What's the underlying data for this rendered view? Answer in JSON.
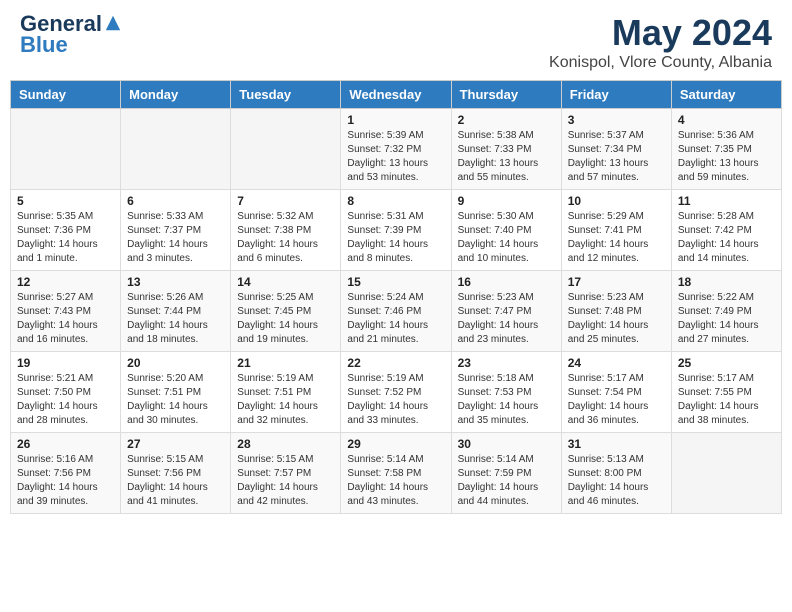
{
  "header": {
    "logo_line1": "General",
    "logo_line2": "Blue",
    "month_title": "May 2024",
    "location": "Konispol, Vlore County, Albania"
  },
  "weekdays": [
    "Sunday",
    "Monday",
    "Tuesday",
    "Wednesday",
    "Thursday",
    "Friday",
    "Saturday"
  ],
  "weeks": [
    [
      {
        "day": "",
        "sunrise": "",
        "sunset": "",
        "daylight": ""
      },
      {
        "day": "",
        "sunrise": "",
        "sunset": "",
        "daylight": ""
      },
      {
        "day": "",
        "sunrise": "",
        "sunset": "",
        "daylight": ""
      },
      {
        "day": "1",
        "sunrise": "Sunrise: 5:39 AM",
        "sunset": "Sunset: 7:32 PM",
        "daylight": "Daylight: 13 hours and 53 minutes."
      },
      {
        "day": "2",
        "sunrise": "Sunrise: 5:38 AM",
        "sunset": "Sunset: 7:33 PM",
        "daylight": "Daylight: 13 hours and 55 minutes."
      },
      {
        "day": "3",
        "sunrise": "Sunrise: 5:37 AM",
        "sunset": "Sunset: 7:34 PM",
        "daylight": "Daylight: 13 hours and 57 minutes."
      },
      {
        "day": "4",
        "sunrise": "Sunrise: 5:36 AM",
        "sunset": "Sunset: 7:35 PM",
        "daylight": "Daylight: 13 hours and 59 minutes."
      }
    ],
    [
      {
        "day": "5",
        "sunrise": "Sunrise: 5:35 AM",
        "sunset": "Sunset: 7:36 PM",
        "daylight": "Daylight: 14 hours and 1 minute."
      },
      {
        "day": "6",
        "sunrise": "Sunrise: 5:33 AM",
        "sunset": "Sunset: 7:37 PM",
        "daylight": "Daylight: 14 hours and 3 minutes."
      },
      {
        "day": "7",
        "sunrise": "Sunrise: 5:32 AM",
        "sunset": "Sunset: 7:38 PM",
        "daylight": "Daylight: 14 hours and 6 minutes."
      },
      {
        "day": "8",
        "sunrise": "Sunrise: 5:31 AM",
        "sunset": "Sunset: 7:39 PM",
        "daylight": "Daylight: 14 hours and 8 minutes."
      },
      {
        "day": "9",
        "sunrise": "Sunrise: 5:30 AM",
        "sunset": "Sunset: 7:40 PM",
        "daylight": "Daylight: 14 hours and 10 minutes."
      },
      {
        "day": "10",
        "sunrise": "Sunrise: 5:29 AM",
        "sunset": "Sunset: 7:41 PM",
        "daylight": "Daylight: 14 hours and 12 minutes."
      },
      {
        "day": "11",
        "sunrise": "Sunrise: 5:28 AM",
        "sunset": "Sunset: 7:42 PM",
        "daylight": "Daylight: 14 hours and 14 minutes."
      }
    ],
    [
      {
        "day": "12",
        "sunrise": "Sunrise: 5:27 AM",
        "sunset": "Sunset: 7:43 PM",
        "daylight": "Daylight: 14 hours and 16 minutes."
      },
      {
        "day": "13",
        "sunrise": "Sunrise: 5:26 AM",
        "sunset": "Sunset: 7:44 PM",
        "daylight": "Daylight: 14 hours and 18 minutes."
      },
      {
        "day": "14",
        "sunrise": "Sunrise: 5:25 AM",
        "sunset": "Sunset: 7:45 PM",
        "daylight": "Daylight: 14 hours and 19 minutes."
      },
      {
        "day": "15",
        "sunrise": "Sunrise: 5:24 AM",
        "sunset": "Sunset: 7:46 PM",
        "daylight": "Daylight: 14 hours and 21 minutes."
      },
      {
        "day": "16",
        "sunrise": "Sunrise: 5:23 AM",
        "sunset": "Sunset: 7:47 PM",
        "daylight": "Daylight: 14 hours and 23 minutes."
      },
      {
        "day": "17",
        "sunrise": "Sunrise: 5:23 AM",
        "sunset": "Sunset: 7:48 PM",
        "daylight": "Daylight: 14 hours and 25 minutes."
      },
      {
        "day": "18",
        "sunrise": "Sunrise: 5:22 AM",
        "sunset": "Sunset: 7:49 PM",
        "daylight": "Daylight: 14 hours and 27 minutes."
      }
    ],
    [
      {
        "day": "19",
        "sunrise": "Sunrise: 5:21 AM",
        "sunset": "Sunset: 7:50 PM",
        "daylight": "Daylight: 14 hours and 28 minutes."
      },
      {
        "day": "20",
        "sunrise": "Sunrise: 5:20 AM",
        "sunset": "Sunset: 7:51 PM",
        "daylight": "Daylight: 14 hours and 30 minutes."
      },
      {
        "day": "21",
        "sunrise": "Sunrise: 5:19 AM",
        "sunset": "Sunset: 7:51 PM",
        "daylight": "Daylight: 14 hours and 32 minutes."
      },
      {
        "day": "22",
        "sunrise": "Sunrise: 5:19 AM",
        "sunset": "Sunset: 7:52 PM",
        "daylight": "Daylight: 14 hours and 33 minutes."
      },
      {
        "day": "23",
        "sunrise": "Sunrise: 5:18 AM",
        "sunset": "Sunset: 7:53 PM",
        "daylight": "Daylight: 14 hours and 35 minutes."
      },
      {
        "day": "24",
        "sunrise": "Sunrise: 5:17 AM",
        "sunset": "Sunset: 7:54 PM",
        "daylight": "Daylight: 14 hours and 36 minutes."
      },
      {
        "day": "25",
        "sunrise": "Sunrise: 5:17 AM",
        "sunset": "Sunset: 7:55 PM",
        "daylight": "Daylight: 14 hours and 38 minutes."
      }
    ],
    [
      {
        "day": "26",
        "sunrise": "Sunrise: 5:16 AM",
        "sunset": "Sunset: 7:56 PM",
        "daylight": "Daylight: 14 hours and 39 minutes."
      },
      {
        "day": "27",
        "sunrise": "Sunrise: 5:15 AM",
        "sunset": "Sunset: 7:56 PM",
        "daylight": "Daylight: 14 hours and 41 minutes."
      },
      {
        "day": "28",
        "sunrise": "Sunrise: 5:15 AM",
        "sunset": "Sunset: 7:57 PM",
        "daylight": "Daylight: 14 hours and 42 minutes."
      },
      {
        "day": "29",
        "sunrise": "Sunrise: 5:14 AM",
        "sunset": "Sunset: 7:58 PM",
        "daylight": "Daylight: 14 hours and 43 minutes."
      },
      {
        "day": "30",
        "sunrise": "Sunrise: 5:14 AM",
        "sunset": "Sunset: 7:59 PM",
        "daylight": "Daylight: 14 hours and 44 minutes."
      },
      {
        "day": "31",
        "sunrise": "Sunrise: 5:13 AM",
        "sunset": "Sunset: 8:00 PM",
        "daylight": "Daylight: 14 hours and 46 minutes."
      },
      {
        "day": "",
        "sunrise": "",
        "sunset": "",
        "daylight": ""
      }
    ]
  ]
}
